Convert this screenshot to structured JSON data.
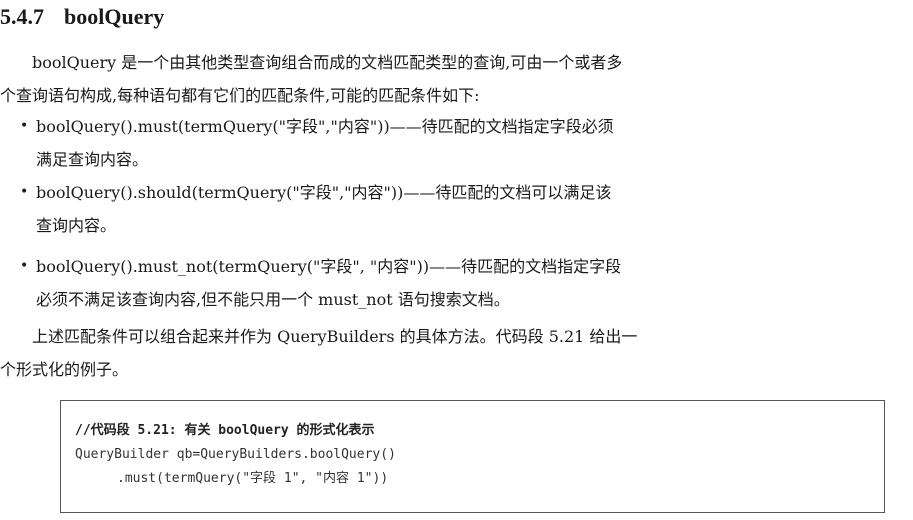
{
  "heading": {
    "number": "5.4.7",
    "title": "boolQuery"
  },
  "intro": {
    "line1": "boolQuery 是一个由其他类型查询组合而成的文档匹配类型的查询,可由一个或者多",
    "line2": "个查询语句构成,每种语句都有它们的匹配条件,可能的匹配条件如下:"
  },
  "bullets": [
    {
      "line1": "boolQuery().must(termQuery(\"字段\",\"内容\"))——待匹配的文档指定字段必须",
      "line2": "满足查询内容。"
    },
    {
      "line1": "boolQuery().should(termQuery(\"字段\",\"内容\"))——待匹配的文档可以满足该",
      "line2": "查询内容。"
    },
    {
      "line1": "boolQuery().must_not(termQuery(\"字段\", \"内容\"))——待匹配的文档指定字段",
      "line2": "必须不满足该查询内容,但不能只用一个 must_not 语句搜索文档。"
    }
  ],
  "summary": {
    "line1": "上述匹配条件可以组合起来并作为 QueryBuilders 的具体方法。代码段 5.21 给出一",
    "line2": "个形式化的例子。"
  },
  "code": {
    "comment": "//代码段 5.21: 有关 boolQuery 的形式化表示",
    "line1": "QueryBuilder qb=QueryBuilders.boolQuery()",
    "line2": ".must(termQuery(\"字段 1\", \"内容 1\"))"
  }
}
